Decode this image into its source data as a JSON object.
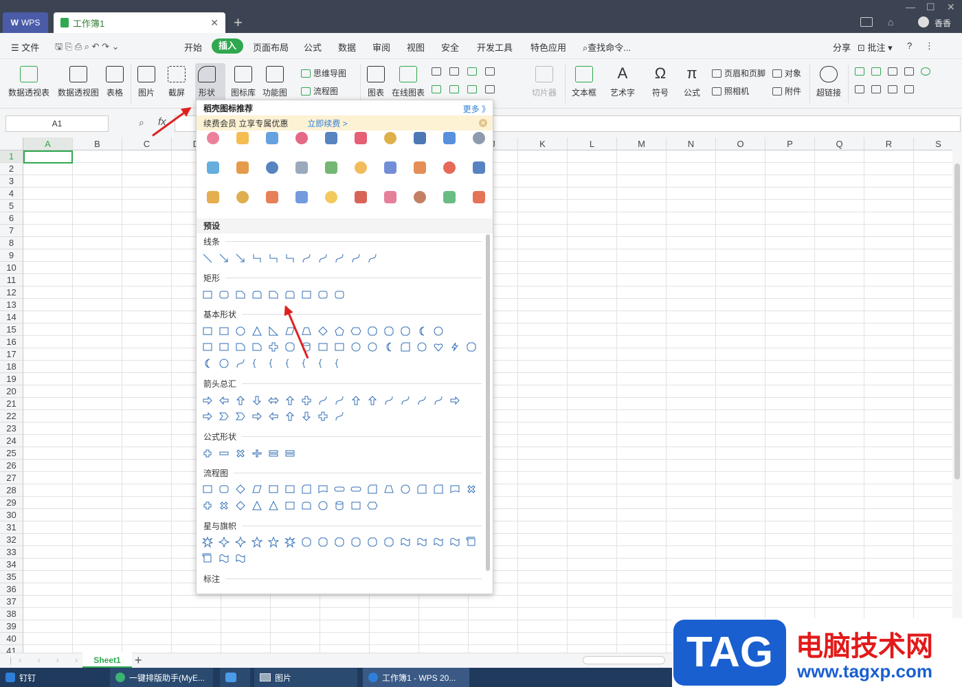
{
  "titlebar": {
    "app": "WPS",
    "doc_tab": "工作簿1",
    "new_tab": "+",
    "user": "香香"
  },
  "menubar": {
    "file": "文件",
    "items": [
      "开始",
      "插入",
      "页面布局",
      "公式",
      "数据",
      "审阅",
      "视图",
      "安全",
      "开发工具",
      "特色应用"
    ],
    "active": "插入",
    "search": "查找命令...",
    "share": "分享",
    "comment": "批注"
  },
  "ribbon": {
    "big": [
      "数据透视表",
      "数据透视图",
      "表格",
      "图片",
      "截屏",
      "形状",
      "图标库",
      "功能图",
      "图表",
      "在线图表",
      "切片器",
      "文本框",
      "艺术字",
      "符号",
      "公式",
      "超链接"
    ],
    "small": [
      "思维导图",
      "流程图",
      "页眉和页脚",
      "对象",
      "照相机",
      "附件"
    ]
  },
  "formula": {
    "cell_ref": "A1",
    "fx": "fx"
  },
  "grid": {
    "columns": [
      "A",
      "B",
      "C",
      "D",
      "E",
      "F",
      "G",
      "H",
      "I",
      "J",
      "K",
      "L",
      "M",
      "N",
      "O",
      "P",
      "Q",
      "R",
      "S"
    ],
    "rows": [
      "1",
      "2",
      "3",
      "4",
      "5",
      "6",
      "7",
      "8",
      "9",
      "10",
      "11",
      "12",
      "13",
      "14",
      "15",
      "16",
      "17",
      "18",
      "19",
      "20",
      "21",
      "22",
      "23",
      "24",
      "25",
      "26",
      "27",
      "28",
      "29",
      "30",
      "31",
      "32",
      "33",
      "34",
      "35",
      "36",
      "37",
      "38",
      "39",
      "40",
      "41"
    ]
  },
  "sheets": {
    "active": "Sheet1",
    "add": "+"
  },
  "dropdown": {
    "title": "稻壳图标推荐",
    "more": "更多 》",
    "promo_text": "续费会员 立享专属优惠",
    "promo_link": "立即续费 >",
    "preset": "预设",
    "categories": [
      "线条",
      "矩形",
      "基本形状",
      "箭头总汇",
      "公式形状",
      "流程图",
      "星与旗帜",
      "标注"
    ]
  },
  "taskbar": [
    "钉钉",
    "一键排版助手(MyE...",
    "",
    "图片",
    "工作簿1 - WPS 20..."
  ],
  "watermark": {
    "tag": "TAG",
    "cn": "电脑技术网",
    "url": "www.tagxp.com"
  }
}
